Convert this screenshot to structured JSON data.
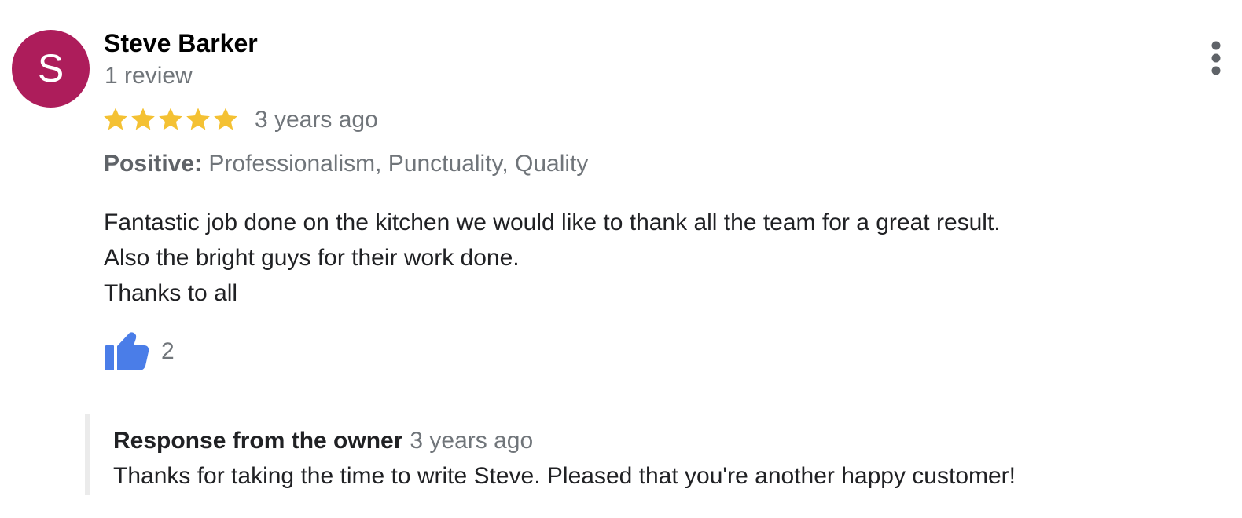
{
  "reviewer": {
    "avatar_initial": "S",
    "avatar_color": "#ad1d5b",
    "name": "Steve Barker",
    "review_count": "1 review"
  },
  "menu": {
    "icon": "more-vert-icon"
  },
  "rating": {
    "stars": 5,
    "max_stars": 5,
    "star_color": "#f4c133",
    "date": "3 years ago"
  },
  "attributes": {
    "label": "Positive:",
    "values": "Professionalism, Punctuality, Quality"
  },
  "review": {
    "lines": [
      "Fantastic job done on the kitchen we would like to thank all the team for a great result.",
      "Also the bright guys for their work done.",
      "Thanks to all"
    ]
  },
  "likes": {
    "icon": "thumbs-up-icon",
    "icon_color": "#4a7de8",
    "count": "2"
  },
  "owner_response": {
    "title": "Response from the owner",
    "date": "3 years ago",
    "text": "Thanks for taking the time to write Steve. Pleased that you're another happy customer!"
  }
}
